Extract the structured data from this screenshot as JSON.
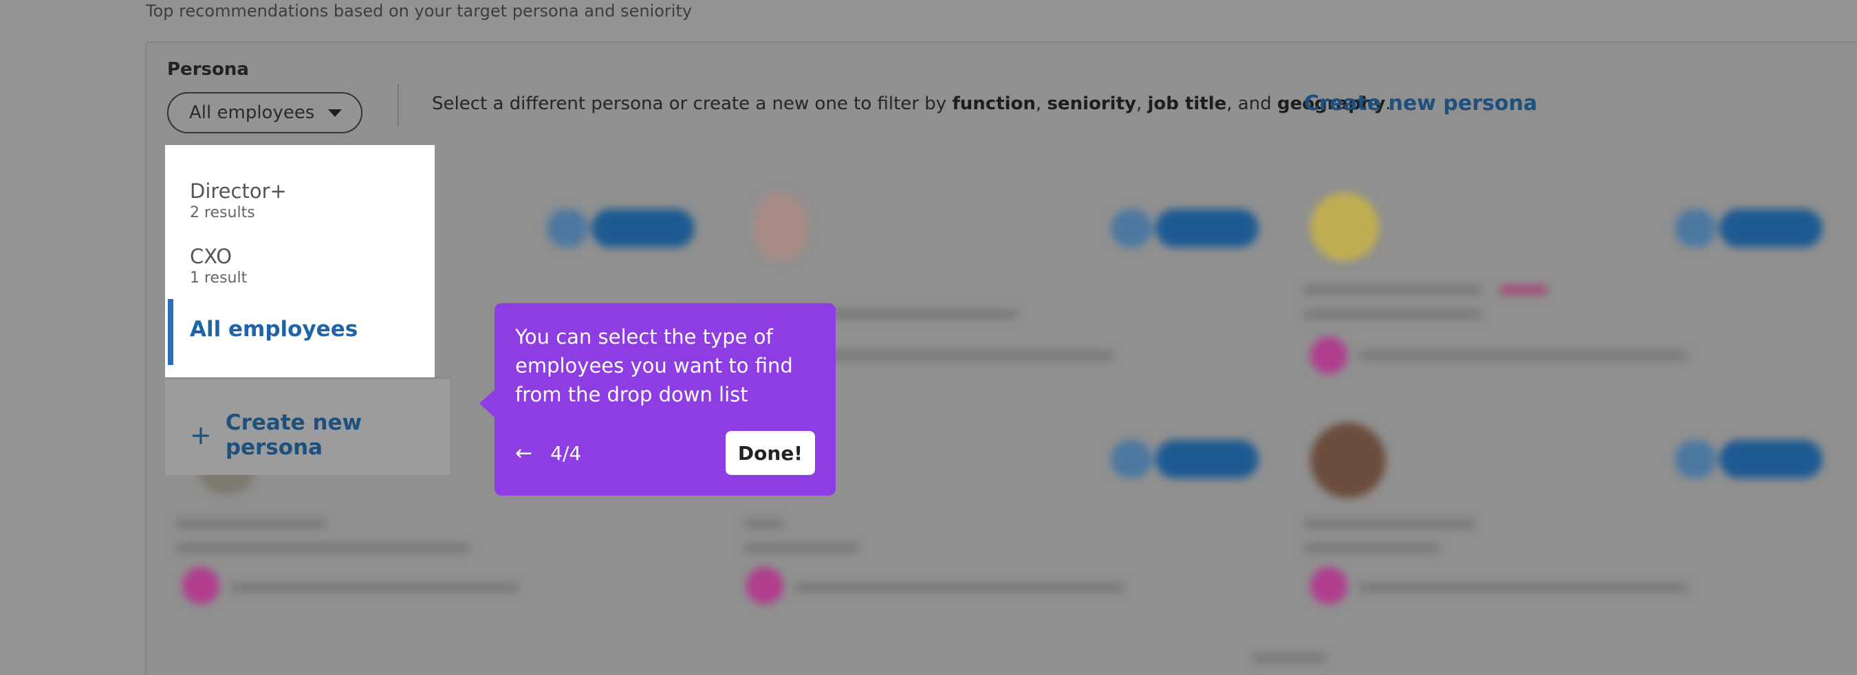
{
  "header": {
    "subtitle": "Top recommendations based on your target persona and seniority"
  },
  "persona": {
    "label": "Persona",
    "selected_value": "All employees",
    "description_parts": {
      "lead": "Select a different persona or create a new one to filter by ",
      "function": "function",
      "sep1": ", ",
      "seniority": "seniority",
      "sep2": ", ",
      "job_title": "job title",
      "sep3": ", and ",
      "geography": "geography",
      "end": "."
    },
    "create_link": "Create new persona"
  },
  "dropdown": {
    "options": [
      {
        "title": "Director+",
        "sub": "2 results"
      },
      {
        "title": "CXO",
        "sub": "1 result"
      }
    ],
    "selected": "All employees",
    "create_label": "Create new persona"
  },
  "tooltip": {
    "text": "You can select the type of employees you want to find from the drop down list",
    "step": "4/4",
    "done_label": "Done!"
  },
  "colors": {
    "tooltip_bg": "#8e3de3",
    "link": "#1e4f7d",
    "selected_accent": "#2a6fb5"
  }
}
